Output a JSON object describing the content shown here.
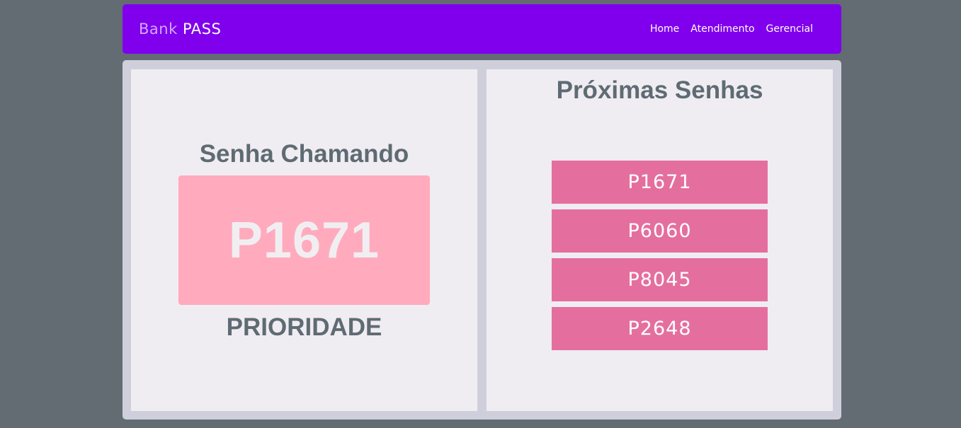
{
  "navbar": {
    "brand_light": "Bank",
    "brand_bold": "PASS",
    "links": [
      "Home",
      "Atendimento",
      "Gerencial"
    ]
  },
  "current": {
    "title": "Senha Chamando",
    "code": "P1671",
    "type": "PRIORIDADE"
  },
  "next": {
    "title": "Próximas Senhas",
    "codes": [
      "P1671",
      "P6060",
      "P8045",
      "P2648"
    ]
  },
  "colors": {
    "background": "#636c72",
    "navbar": "#8000ed",
    "current_box": "#ffabbd",
    "next_item": "#e46f9f",
    "heading_text": "#5f6b73"
  }
}
